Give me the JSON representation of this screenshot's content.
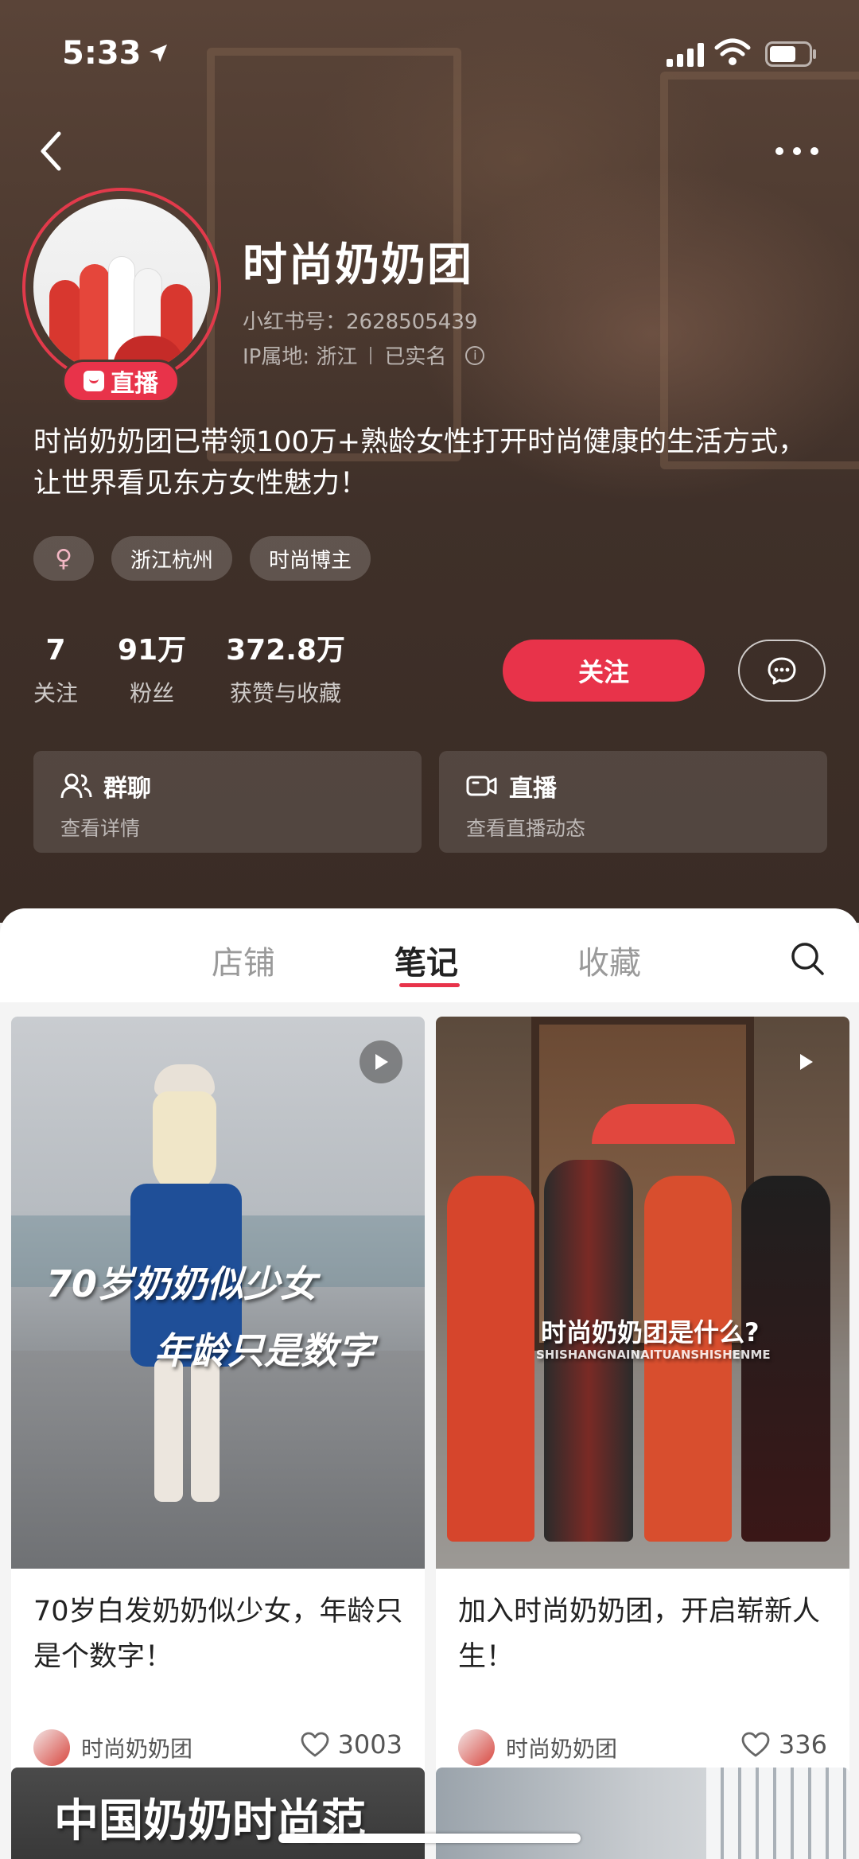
{
  "status_bar": {
    "time": "5:33"
  },
  "profile": {
    "nickname": "时尚奶奶团",
    "red_id": "小红书号：2628505439",
    "ip_location": "IP属地: 浙江",
    "verified": "已实名",
    "live_badge": "直播",
    "bio": "时尚奶奶团已带领100万+熟龄女性打开时尚健康的生活方式，让世界看见东方女性魅力！",
    "tags": [
      "♀",
      "浙江杭州",
      "时尚博主"
    ],
    "stats": [
      {
        "value": "7",
        "label": "关注"
      },
      {
        "value": "91万",
        "label": "粉丝"
      },
      {
        "value": "372.8万",
        "label": "获赞与收藏"
      }
    ],
    "follow_label": "关注",
    "cards": [
      {
        "title": "群聊",
        "sub": "查看详情"
      },
      {
        "title": "直播",
        "sub": "查看直播动态"
      }
    ]
  },
  "tabs": [
    {
      "label": "店铺"
    },
    {
      "label": "笔记"
    },
    {
      "label": "收藏"
    }
  ],
  "notes": [
    {
      "cover_text_1": "70岁奶奶似少女",
      "cover_text_2": "年龄只是数字",
      "title": "70岁白发奶奶似少女，年龄只是个数字！",
      "author": "时尚奶奶团",
      "likes": "3003"
    },
    {
      "cover_text_1": "时尚奶奶团是什么?",
      "cover_text_2": "SHISHANGNAINAITUANSHISHENME",
      "title": "加入时尚奶奶团，开启崭新人生！",
      "author": "时尚奶奶团",
      "likes": "336"
    },
    {
      "cover_text_1": "中国奶奶时尚范"
    }
  ],
  "colors": {
    "accent": "#e8334a",
    "header_bg": "#3f3029"
  }
}
